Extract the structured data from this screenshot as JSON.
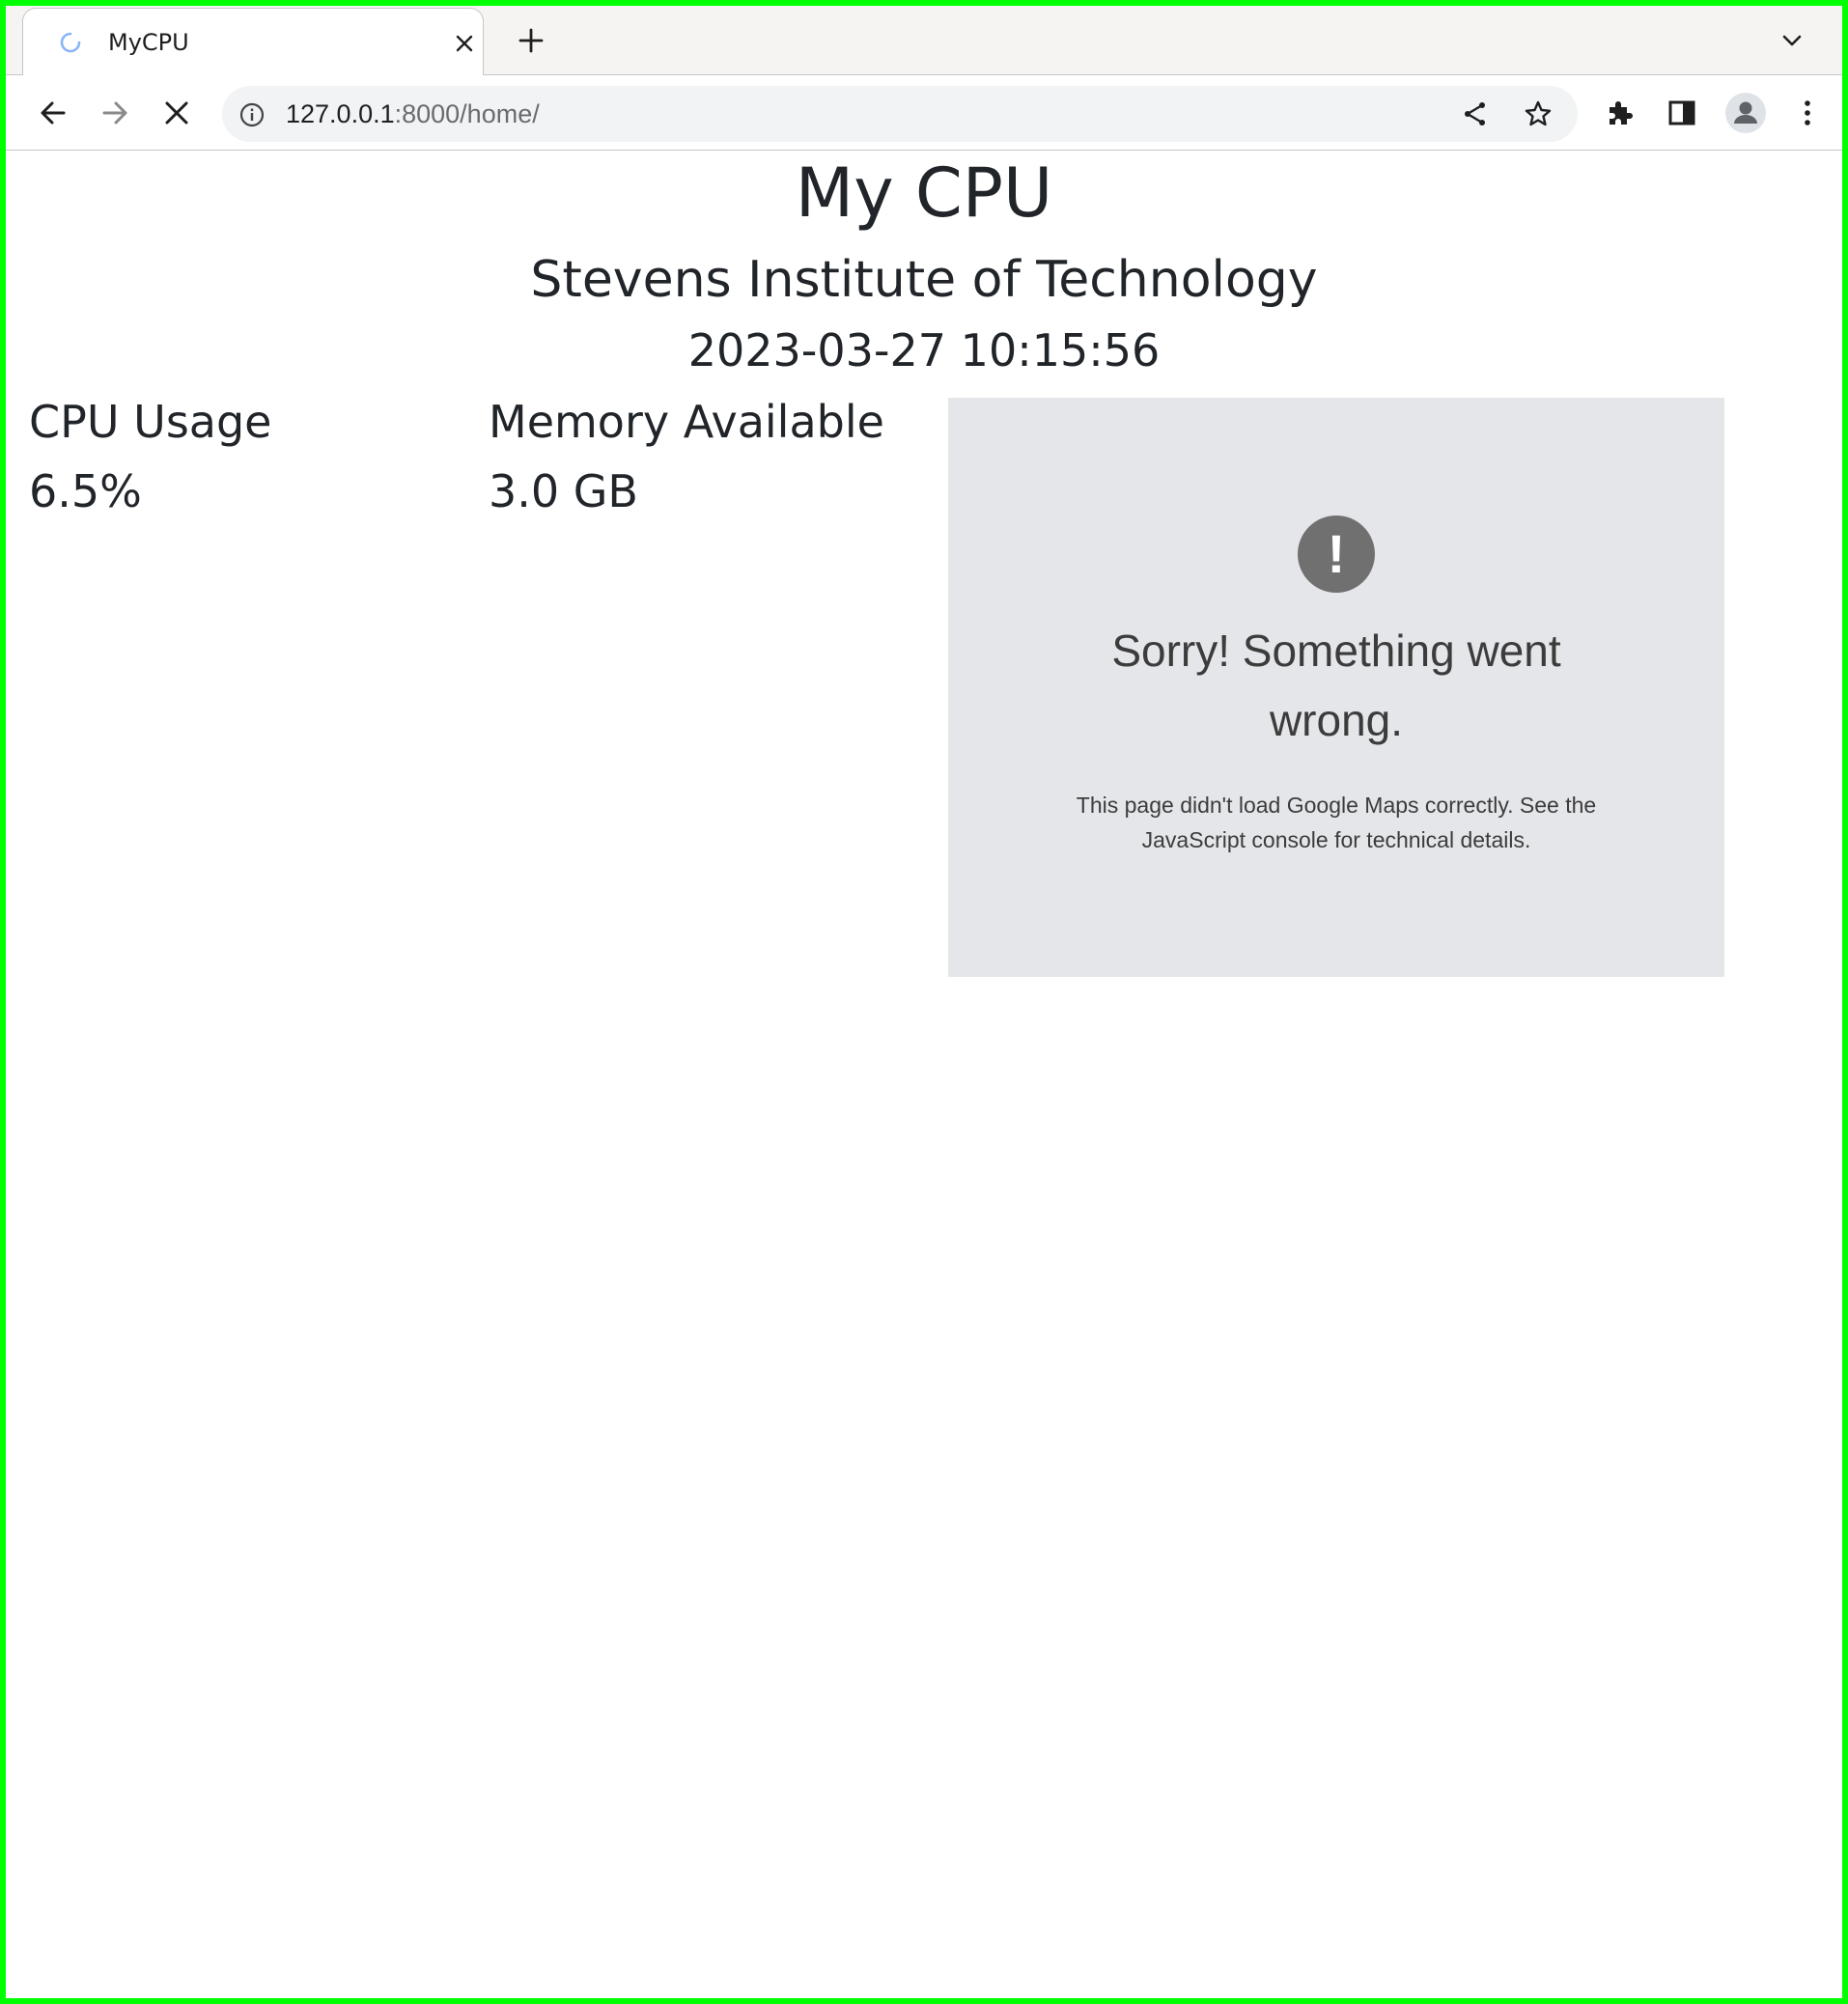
{
  "browser": {
    "tab": {
      "title": "MyCPU",
      "loading": true
    },
    "address_bar": {
      "host": "127.0.0.1",
      "path": ":8000/home/"
    },
    "icons": {
      "back": "arrow-left-icon",
      "forward": "arrow-right-icon",
      "stop": "close-icon",
      "info": "info-icon",
      "share": "share-icon",
      "bookmark": "star-icon",
      "extensions": "puzzle-icon",
      "side_panel": "side-panel-icon",
      "profile": "avatar-icon",
      "menu": "kebab-menu-icon",
      "tab_search": "chevron-down-icon",
      "new_tab": "plus-icon"
    }
  },
  "page": {
    "title": "My CPU",
    "subtitle": "Stevens Institute of Technology",
    "timestamp": "2023-03-27 10:15:56",
    "cpu": {
      "label": "CPU Usage",
      "value": "6.5%"
    },
    "memory": {
      "label": "Memory Available",
      "value": "3.0 GB"
    },
    "map_error": {
      "icon_glyph": "!",
      "title": "Sorry! Something went wrong.",
      "detail": "This page didn't load Google Maps correctly. See the JavaScript console for technical details."
    }
  },
  "colors": {
    "frame_border": "#00ff00",
    "tab_strip_bg": "#f5f4f2",
    "omnibox_bg": "#f1f3f4",
    "page_text": "#212529",
    "map_bg": "#e5e6ea",
    "map_icon_bg": "#707070",
    "map_text": "#3c3c3c",
    "spinner": "#8ab4f8"
  }
}
